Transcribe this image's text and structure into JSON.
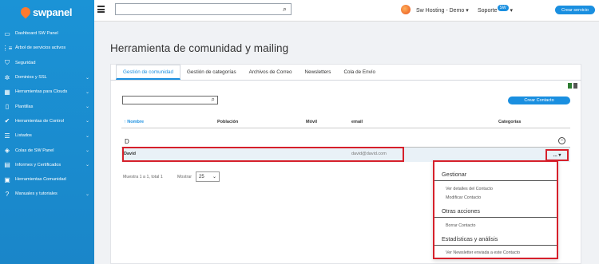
{
  "brand": {
    "name": "swpanel",
    "logo_color": "#ff7a2f",
    "accent": "#1a8fe0",
    "highlight": "#d6202b"
  },
  "sidebar": {
    "items": [
      {
        "label": "Dashboard SW Panel",
        "icon": "dashboard-icon",
        "has_submenu": false
      },
      {
        "label": "Árbol de servicios activos",
        "icon": "tree-icon",
        "has_submenu": false
      },
      {
        "label": "Seguridad",
        "icon": "shield-icon",
        "has_submenu": false
      },
      {
        "label": "Dominios y SSL",
        "icon": "domain-icon",
        "has_submenu": true
      },
      {
        "label": "Herramientas para Clouds",
        "icon": "cloud-tools-icon",
        "has_submenu": true
      },
      {
        "label": "Plantillas",
        "icon": "template-icon",
        "has_submenu": true
      },
      {
        "label": "Herramientas de Control",
        "icon": "check-circle-icon",
        "has_submenu": true
      },
      {
        "label": "Listados",
        "icon": "list-icon",
        "has_submenu": true
      },
      {
        "label": "Colas de SW Panel",
        "icon": "layers-icon",
        "has_submenu": true
      },
      {
        "label": "Informes y Certificados",
        "icon": "report-icon",
        "has_submenu": true
      },
      {
        "label": "Herramientas Comunidad",
        "icon": "community-icon",
        "has_submenu": false
      },
      {
        "label": "Manuales y tutoriales",
        "icon": "help-icon",
        "has_submenu": true
      }
    ]
  },
  "topbar": {
    "search_value": "",
    "account": "Sw Hosting - Demo",
    "support_label": "Soporte",
    "support_badge": "SW",
    "create_service": "Crear servicio"
  },
  "page": {
    "title": "Herramienta de comunidad y mailing"
  },
  "tabs": [
    {
      "label": "Gestión de comunidad",
      "active": true
    },
    {
      "label": "Gestión de categorías",
      "active": false
    },
    {
      "label": "Archivos de Correo",
      "active": false
    },
    {
      "label": "Newsletters",
      "active": false
    },
    {
      "label": "Cola de Envío",
      "active": false
    }
  ],
  "toolbar": {
    "filter_value": "",
    "create_contact": "Crear Contacto"
  },
  "table": {
    "columns": [
      "Nombre",
      "Población",
      "Móvil",
      "email",
      "Categorías"
    ],
    "sort_icon": "↑",
    "group_letter": "D",
    "rows": [
      {
        "nombre": "David",
        "poblacion": "",
        "movil": "",
        "email": "david@david.com",
        "categorias": ""
      }
    ],
    "action_label": "... ▾"
  },
  "pager": {
    "info": "Muestra 1 a 1, total 1",
    "show_label": "Mostrar",
    "page_size": "25"
  },
  "dropdown": {
    "sections": [
      {
        "header": "Gestionar",
        "items": [
          "Ver detalles del Contacto",
          "Modificar Contacto"
        ]
      },
      {
        "header": "Otras acciones",
        "items": [
          "Borrar Contacto"
        ]
      },
      {
        "header": "Estadísticas y análisis",
        "items": [
          "Ver Newsletter enviada a este Contacto"
        ]
      }
    ]
  }
}
